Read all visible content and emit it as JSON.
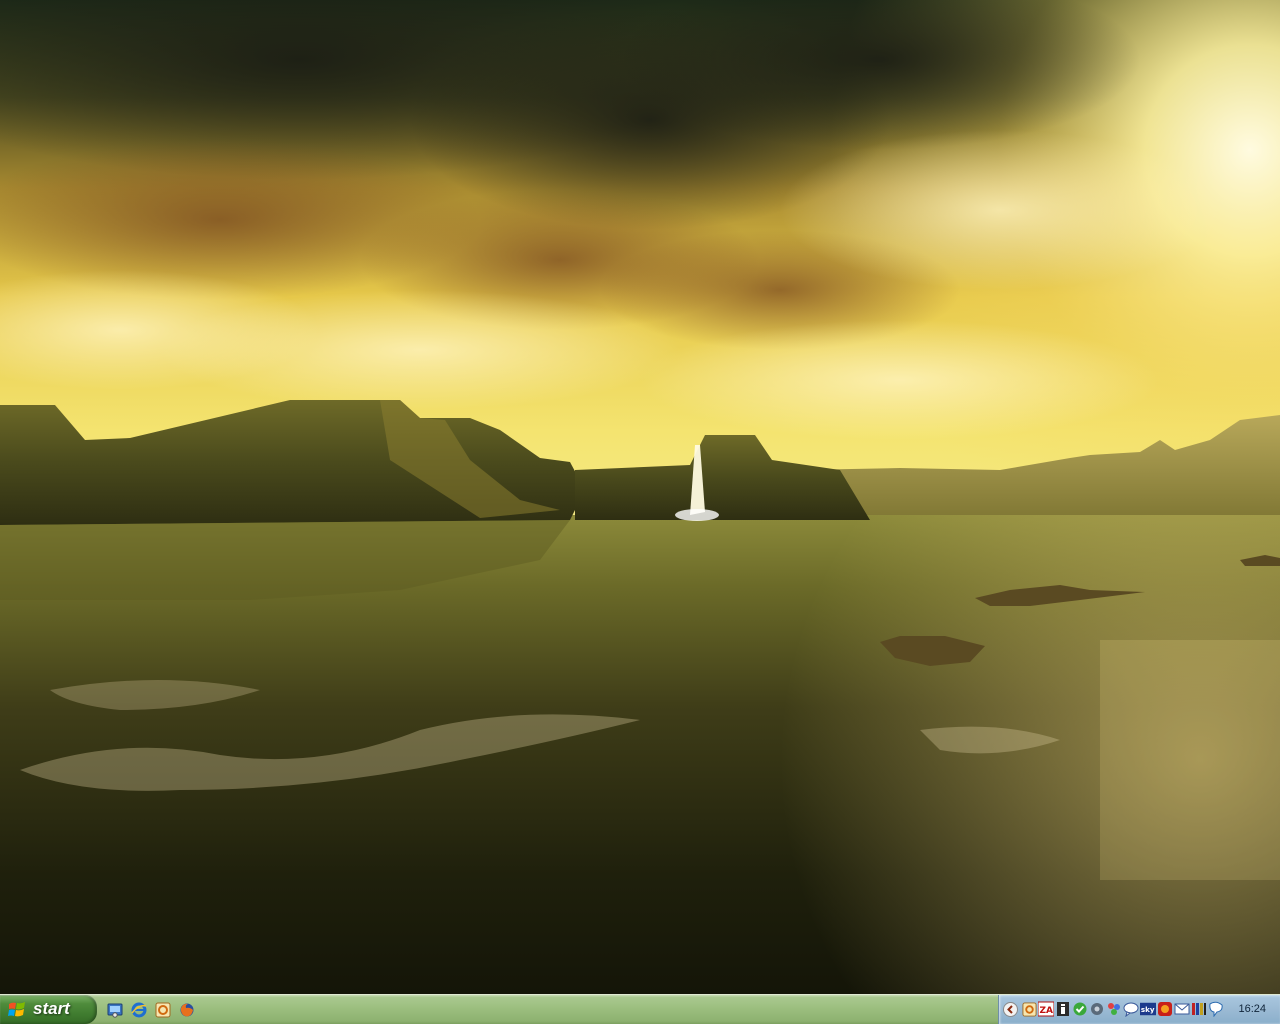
{
  "taskbar": {
    "start_label": "start",
    "quick_launch": [
      {
        "name": "show-desktop",
        "icon": "show-desktop-icon"
      },
      {
        "name": "internet-explorer",
        "icon": "internet-explorer-icon"
      },
      {
        "name": "outlook-express",
        "icon": "outlook-icon"
      },
      {
        "name": "firefox",
        "icon": "firefox-icon"
      }
    ],
    "tray": {
      "clock": "16:24",
      "icons": [
        "app-tray-icon",
        "zonealarm-icon",
        "info-icon",
        "security-icon",
        "gear-icon",
        "network-icon",
        "messenger-icon",
        "sky-icon",
        "firefox-tray-icon",
        "mail-icon",
        "volume-bars-icon",
        "speech-icon"
      ],
      "sky_text": "sky",
      "za_text": "ZA"
    }
  },
  "colors": {
    "taskbar_green": "#9cbf7f",
    "start_green": "#3e7a2e",
    "tray_blue": "#9bbad4",
    "sky_gold": "#f3d24a",
    "water_dark": "#1e200c"
  }
}
